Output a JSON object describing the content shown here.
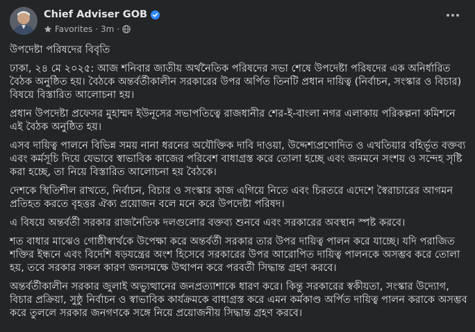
{
  "post": {
    "author": "Chief Adviser GOB",
    "meta_feed": "Favorites",
    "meta_time": "3m",
    "paragraphs": [
      "উপদেষ্টা পরিষদের বিবৃতি",
      "ঢাকা, ২৪ মে ২০২৫: আজ শনিবার জাতীয় অর্থনৈতিক পরিষদের সভা শেষে উপদেষ্টা পরিষদের এক অনির্ধারিত বৈঠক অনুষ্ঠিত হয়। বৈঠকে অন্তর্বর্তীকালীন সরকারের উপর অর্পিত তিনটি প্রধান দায়িত্ব (নির্বাচন, সংস্কার ও বিচার) বিষয়ে বিস্তারিত আলোচনা হয়।",
      "প্রধান উপদেষ্টা প্রফেসর মুহাম্মদ ইউনূসের সভাপতিত্বে রাজধানীর শের-ই-বাংলা নগর এলাকায় পরিকল্পনা কমিশনে এই বৈঠক অনুষ্ঠিত হয়।",
      "এসব দায়িত্ব পালনে বিভিন্ন সময় নানা ধরনের অযৌক্তিক দাবি দাওয়া, উদ্দেশ্যপ্রণোদিত ও এখতিয়ার বহির্ভূত বক্তব্য এবং কর্মসূচি দিয়ে যেভাবে স্বাভাবিক কাজের পরিবেশ বাধাগ্রস্ত করে তোলা হচ্ছে এবং জনমনে সংশয় ও সন্দেহ সৃষ্টি করা হচ্ছে, তা নিয়ে বিস্তারিত আলোচনা হয় বৈঠকে।",
      "দেশকে স্থিতিশীল রাখতে, নির্বাচন, বিচার ও সংস্কার কাজ এগিয়ে নিতে এবং চিরতরে এদেশে স্বৈরাচারের আগমন প্রতিহত করতে বৃহত্তর ঐক্য প্রয়োজন বলে মনে করে উপদেষ্টা পরিষদ।",
      "এ বিষয়ে অন্তর্বর্তী সরকার রাজনৈতিক দলগুলোর বক্তব্য শুনবে এবং সরকারের অবস্থান স্পষ্ট করবে।",
      "শত বাধার মাঝেও গোষ্ঠীস্বার্থকে উপেক্ষা করে অন্তর্বর্তী সরকার তার উপর দায়িত্ব পালন করে যাচ্ছে। যদি পরাজিত শক্তির ইন্ধনে এবং বিদেশি ষড়যন্ত্রের অংশ হিসেবে সরকারের উপর আরোপিত দায়িত্ব পালনকে অসম্ভব করে তোলা হয়, তবে সরকার সকল কারণ জনসমক্ষে উত্থাপন করে পরবর্তী সিদ্ধান্ত গ্রহণ করবে।",
      "অন্তর্বর্তীকালীন সরকার জুলাই অভ্যুত্থানের জনপ্রত্যাশাকে ধারণ করে। কিন্তু সরকারের স্বকীয়তা, সংস্কার উদ্যোগ, বিচার প্রক্রিয়া, সুষ্ঠু নির্বাচন ও স্বাভাবিক কার্যক্রমকে বাধাগ্রস্ত করে এমন কর্মকাণ্ড অর্পিত দায়িত্ব পালন করাকে অসম্ভব করে তুললে সরকার জনগণকে সঙ্গে নিয়ে প্রয়োজনীয় সিদ্ধান্ত গ্রহণ করবে।"
    ],
    "icons": {
      "verified": "verified-badge-icon",
      "favorite": "star-icon",
      "globe": "globe-icon",
      "more": "more-options-icon"
    },
    "colors": {
      "background": "#242526",
      "text": "#e4e6eb",
      "muted": "#b0b3b8",
      "verified": "#2d88ff"
    }
  }
}
